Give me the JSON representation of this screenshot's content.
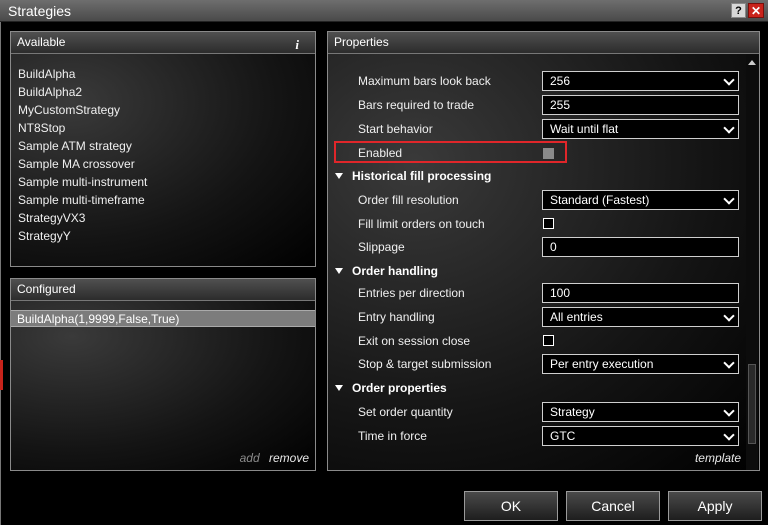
{
  "window": {
    "title": "Strategies",
    "help_label": "?",
    "close_label": "✕"
  },
  "available": {
    "header": "Available",
    "info_icon": "i",
    "items": [
      "BuildAlpha",
      "BuildAlpha2",
      "MyCustomStrategy",
      "NT8Stop",
      "Sample ATM strategy",
      "Sample MA crossover",
      "Sample multi-instrument",
      "Sample multi-timeframe",
      "StrategyVX3",
      "StrategyY"
    ]
  },
  "configured": {
    "header": "Configured",
    "items": [
      "BuildAlpha(1,9999,False,True)"
    ],
    "add_label": "add",
    "remove_label": "remove"
  },
  "properties": {
    "header": "Properties",
    "max_bars_label": "Maximum bars look back",
    "max_bars_value": "256",
    "bars_required_label": "Bars required to trade",
    "bars_required_value": "255",
    "start_behavior_label": "Start behavior",
    "start_behavior_value": "Wait until flat",
    "enabled_label": "Enabled",
    "enabled_checked": false,
    "historical_section": "Historical fill processing",
    "order_fill_label": "Order fill resolution",
    "order_fill_value": "Standard (Fastest)",
    "fill_limit_label": "Fill limit orders on touch",
    "fill_limit_checked": false,
    "slippage_label": "Slippage",
    "slippage_value": "0",
    "order_handling_section": "Order handling",
    "entries_per_direction_label": "Entries per direction",
    "entries_per_direction_value": "100",
    "entry_handling_label": "Entry handling",
    "entry_handling_value": "All entries",
    "exit_on_close_label": "Exit on session close",
    "exit_on_close_checked": false,
    "stop_target_label": "Stop & target submission",
    "stop_target_value": "Per entry execution",
    "order_properties_section": "Order properties",
    "set_order_qty_label": "Set order quantity",
    "set_order_qty_value": "Strategy",
    "time_in_force_label": "Time in force",
    "time_in_force_value": "GTC",
    "template_label": "template"
  },
  "buttons": {
    "ok": "OK",
    "cancel": "Cancel",
    "apply": "Apply"
  },
  "colors": {
    "highlight": "#e0262a",
    "close": "#c9231b",
    "selected_row": "#7c7c7c"
  }
}
